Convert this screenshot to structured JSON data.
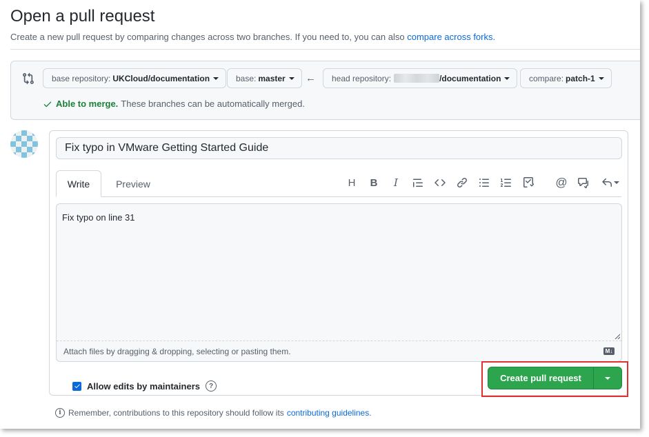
{
  "page": {
    "title": "Open a pull request",
    "subtitle": "Create a new pull request by comparing changes across two branches. If you need to, you can also",
    "subtitle_link": "compare across forks."
  },
  "compare": {
    "base_repository_label": "base repository:",
    "base_repository_value": "UKCloud/documentation",
    "base_label": "base:",
    "base_value": "master",
    "head_repository_label": "head repository:",
    "head_repository_value": "/documentation",
    "compare_label": "compare:",
    "compare_value": "patch-1",
    "merge_status": "Able to merge.",
    "merge_message": "These branches can be automatically merged."
  },
  "form": {
    "title_value": "Fix typo in VMware Getting Started Guide",
    "tabs": [
      {
        "label": "Write",
        "active": true
      },
      {
        "label": "Preview",
        "active": false
      }
    ],
    "toolbar": [
      "heading-icon",
      "bold-icon",
      "italic-icon",
      "quote-icon",
      "code-icon",
      "link-icon",
      "unordered-list-icon",
      "ordered-list-icon",
      "task-list-icon",
      "mention-icon",
      "cross-reference-icon",
      "reply-icon"
    ],
    "body_value": "Fix typo on line 31",
    "attach_text": "Attach files by dragging & dropping, selecting or pasting them.",
    "allow_edits_label": "Allow edits by maintainers",
    "allow_edits_checked": true,
    "submit_label": "Create pull request"
  },
  "footer": {
    "note": "Remember, contributions to this repository should follow its",
    "link": "contributing guidelines."
  },
  "colors": {
    "accent_green": "#2da44e",
    "link_blue": "#0969da",
    "success_green": "#1a7f37",
    "highlight_red": "#e03030"
  }
}
